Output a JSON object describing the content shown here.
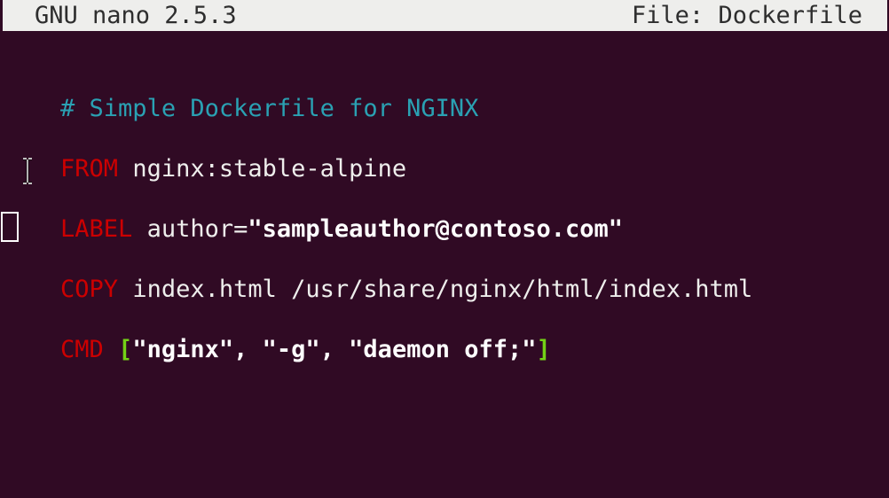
{
  "titlebar": {
    "app": "GNU nano 2.5.3",
    "file": "File: Dockerfile"
  },
  "editor": {
    "comment": "# Simple Dockerfile for NGINX",
    "from_kw": "FROM",
    "from_arg": " nginx:stable-alpine",
    "label_kw": "LABEL",
    "label_key": " author=",
    "label_val": "\"sampleauthor@contoso.com\"",
    "copy_kw": "COPY",
    "copy_arg": " index.html /usr/share/nginx/html/index.html",
    "cmd_kw": "CMD",
    "cmd_space": " ",
    "cmd_open": "[",
    "cmd_args": "\"nginx\", \"-g\", \"daemon off;\"",
    "cmd_close": "]"
  },
  "icons": {
    "text_cursor": "i-beam-cursor-icon",
    "block_cursor": "block-cursor"
  },
  "colors": {
    "background": "#300a24",
    "titlebar": "#eeeeec",
    "comment": "#2aa1b3",
    "keyword": "#cc0000",
    "bracket": "#73d216"
  }
}
